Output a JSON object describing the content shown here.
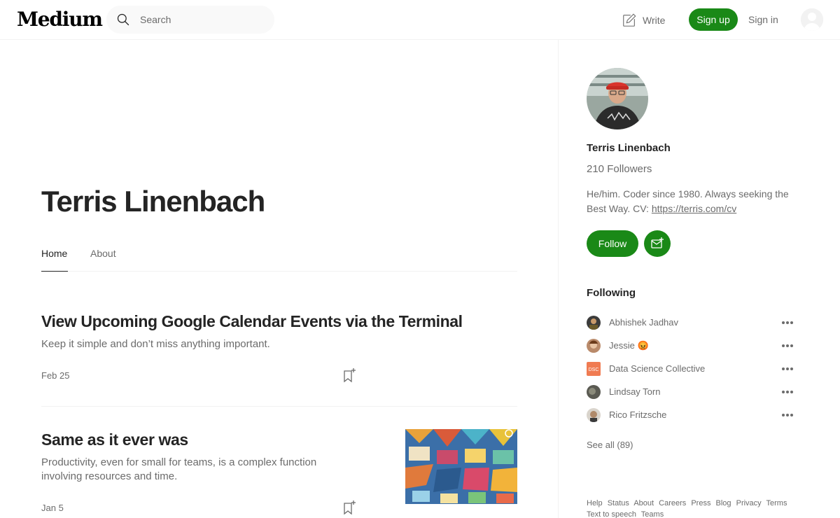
{
  "header": {
    "logo": "Medium",
    "search_placeholder": "Search",
    "write_label": "Write",
    "signup_label": "Sign up",
    "signin_label": "Sign in"
  },
  "profile": {
    "name": "Terris Linenbach",
    "tabs": [
      {
        "label": "Home",
        "active": true
      },
      {
        "label": "About",
        "active": false
      }
    ]
  },
  "posts": [
    {
      "title": "View Upcoming Google Calendar Events via the Terminal",
      "subtitle": "Keep it simple and don’t miss anything important.",
      "date": "Feb 25"
    },
    {
      "title": "Same as it ever was",
      "subtitle": "Productivity, even for small for teams, is a complex function involving resources and time.",
      "date": "Jan 5"
    }
  ],
  "sidebar": {
    "name": "Terris Linenbach",
    "followers": "210 Followers",
    "bio_text": "He/him. Coder since 1980. Always seeking the Best Way. CV: ",
    "bio_link": "https://terris.com/cv",
    "follow_label": "Follow",
    "following_heading": "Following",
    "following": [
      {
        "name": "Abhishek Jadhav"
      },
      {
        "name": "Jessie 😡"
      },
      {
        "name": "Data Science Collective"
      },
      {
        "name": "Lindsay Torn"
      },
      {
        "name": "Rico Fritzsche"
      }
    ],
    "see_all": "See all (89)",
    "footer_links": [
      "Help",
      "Status",
      "About",
      "Careers",
      "Press",
      "Blog",
      "Privacy",
      "Terms",
      "Text to speech",
      "Teams"
    ]
  },
  "colors": {
    "accent_green": "#1a8917",
    "text_primary": "#242424",
    "text_secondary": "#6b6b6b"
  }
}
